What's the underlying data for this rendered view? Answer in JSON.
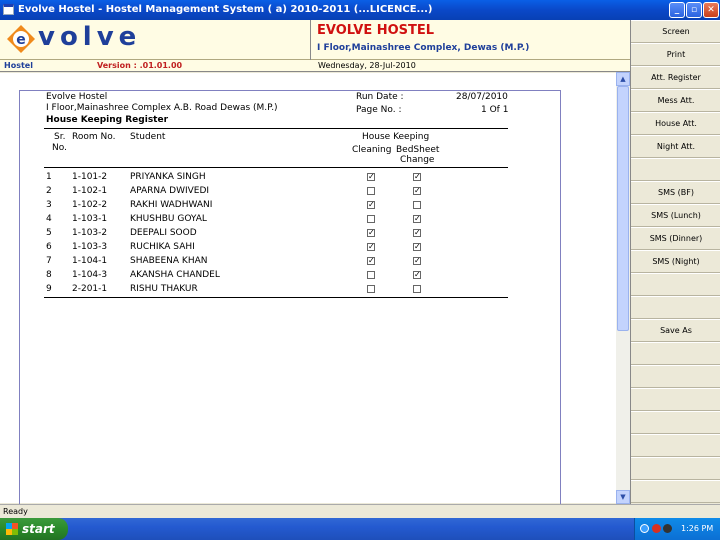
{
  "window": {
    "title": "Evolve Hostel - Hostel Management System ( a) 2010-2011 (...LICENCE...)",
    "min": "_",
    "max": "▫",
    "close": "✕"
  },
  "header": {
    "logo": "volve",
    "title": "EVOLVE HOSTEL",
    "address": "I Floor,Mainashree Complex, Dewas (M.P.)"
  },
  "infobar": {
    "section": "Hostel",
    "version": "Version : .01.01.00",
    "date": "Wednesday, 28-Jul-2010"
  },
  "sidebar": {
    "buttons": [
      "Screen",
      "Print",
      "Att. Register",
      "Mess Att.",
      "House Att.",
      "Night Att.",
      "",
      "SMS (BF)",
      "SMS (Lunch)",
      "SMS (Dinner)",
      "SMS (Night)",
      "",
      "",
      "Save As",
      "",
      "",
      "",
      "",
      "",
      "",
      ""
    ]
  },
  "report": {
    "org": "Evolve Hostel",
    "address": "I Floor,Mainashree Complex A.B. Road Dewas (M.P.)",
    "title": "House Keeping Register",
    "run_date_label": "Run Date :",
    "run_date": "28/07/2010",
    "page_label": "Page No. :",
    "page": "1 Of 1",
    "columns": {
      "sr": "Sr.",
      "sr2": "No.",
      "room": "Room No.",
      "student": "Student",
      "group": "House Keeping",
      "cleaning": "Cleaning",
      "bedsheet": "BedSheet",
      "bedsheet2": "Change"
    },
    "rows": [
      {
        "sr": "1",
        "room": "1-101-2",
        "student": "PRIYANKA SINGH",
        "cleaning": true,
        "bedsheet": true
      },
      {
        "sr": "2",
        "room": "1-102-1",
        "student": "APARNA  DWIVEDI",
        "cleaning": false,
        "bedsheet": true
      },
      {
        "sr": "3",
        "room": "1-102-2",
        "student": "RAKHI WADHWANI",
        "cleaning": true,
        "bedsheet": false
      },
      {
        "sr": "4",
        "room": "1-103-1",
        "student": "KHUSHBU  GOYAL",
        "cleaning": false,
        "bedsheet": true
      },
      {
        "sr": "5",
        "room": "1-103-2",
        "student": "DEEPALI  SOOD",
        "cleaning": true,
        "bedsheet": true
      },
      {
        "sr": "6",
        "room": "1-103-3",
        "student": "RUCHIKA  SAHI",
        "cleaning": true,
        "bedsheet": true
      },
      {
        "sr": "7",
        "room": "1-104-1",
        "student": "SHABEENA KHAN",
        "cleaning": true,
        "bedsheet": true
      },
      {
        "sr": "8",
        "room": "1-104-3",
        "student": "AKANSHA CHANDEL",
        "cleaning": false,
        "bedsheet": true
      },
      {
        "sr": "9",
        "room": "2-201-1",
        "student": "RISHU  THAKUR",
        "cleaning": false,
        "bedsheet": false
      }
    ]
  },
  "status": {
    "text": "Ready"
  },
  "taskbar": {
    "start": "start",
    "time": "1:26 PM"
  }
}
